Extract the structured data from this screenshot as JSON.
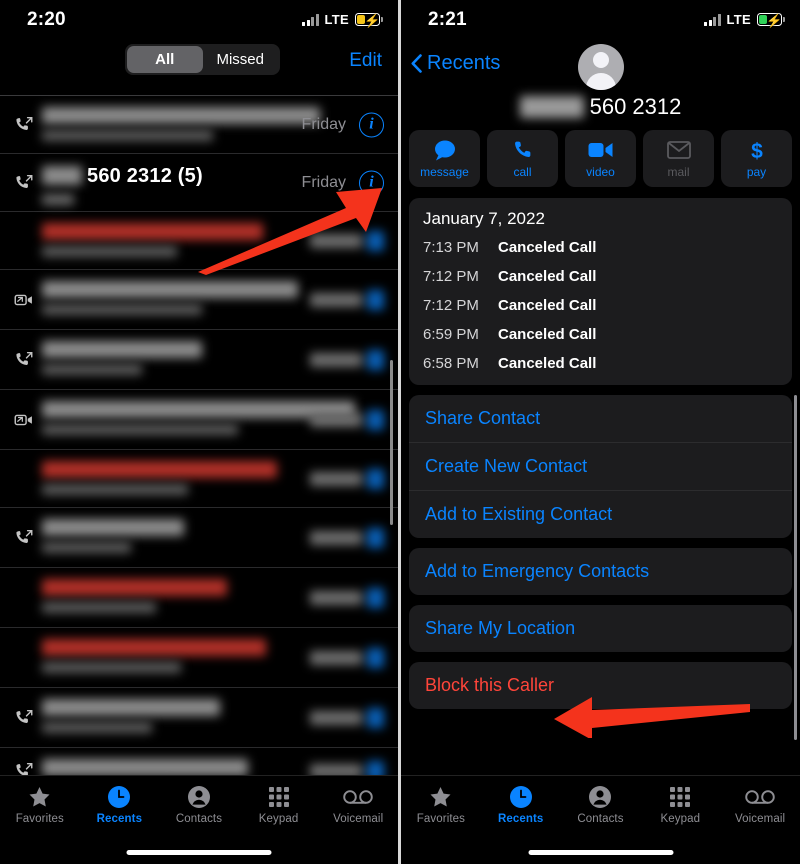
{
  "left": {
    "status": {
      "time": "2:20",
      "network": "LTE",
      "battery_color": "#f5c518",
      "charging": true
    },
    "header": {
      "segments": [
        {
          "label": "All",
          "active": true
        },
        {
          "label": "Missed",
          "active": false
        }
      ],
      "edit_label": "Edit"
    },
    "calls": [
      {
        "name": "",
        "redacted": true,
        "redaction_color": "#8c8c8c",
        "width_pct": 78,
        "when": "Friday",
        "when_visible": true,
        "info": "i",
        "icon": "outgoing-call-icon",
        "height": 58
      },
      {
        "name": "560 2312 (5)",
        "redacted": true,
        "redaction_color": "#8c8c8c",
        "width_pct": 36,
        "when": "Friday",
        "when_visible": true,
        "info": "i",
        "icon": "outgoing-call-icon",
        "height": 58
      },
      {
        "name": "",
        "redacted": true,
        "redaction_color": "#b03028",
        "width_pct": 62,
        "when": "",
        "when_visible": false,
        "info": "i",
        "icon": "none",
        "height": 58
      },
      {
        "name": "",
        "redacted": true,
        "redaction_color": "#8c8c8c",
        "width_pct": 72,
        "when": "",
        "when_visible": false,
        "info": "i",
        "icon": "video-call-icon",
        "height": 60
      },
      {
        "name": "",
        "redacted": true,
        "redaction_color": "#8c8c8c",
        "width_pct": 45,
        "when": "",
        "when_visible": false,
        "info": "i",
        "icon": "outgoing-call-icon",
        "height": 60
      },
      {
        "name": "",
        "redacted": true,
        "redaction_color": "#8c8c8c",
        "width_pct": 88,
        "when": "",
        "when_visible": false,
        "info": "i",
        "icon": "video-call-icon",
        "height": 60
      },
      {
        "name": "",
        "redacted": true,
        "redaction_color": "#b03028",
        "width_pct": 66,
        "when": "",
        "when_visible": false,
        "info": "i",
        "icon": "none",
        "height": 58
      },
      {
        "name": "",
        "redacted": true,
        "redaction_color": "#8c8c8c",
        "width_pct": 40,
        "when": "",
        "when_visible": false,
        "info": "i",
        "icon": "outgoing-call-icon",
        "height": 60
      },
      {
        "name": "",
        "redacted": true,
        "redaction_color": "#b03028",
        "width_pct": 52,
        "when": "",
        "when_visible": false,
        "info": "i",
        "icon": "none",
        "height": 60
      },
      {
        "name": "",
        "redacted": true,
        "redaction_color": "#b03028",
        "width_pct": 63,
        "when": "",
        "when_visible": false,
        "info": "i",
        "icon": "none",
        "height": 60
      },
      {
        "name": "",
        "redacted": true,
        "redaction_color": "#8c8c8c",
        "width_pct": 50,
        "when": "",
        "when_visible": false,
        "info": "i",
        "icon": "outgoing-call-icon",
        "height": 60
      },
      {
        "name": "",
        "redacted": true,
        "redaction_color": "#8c8c8c",
        "width_pct": 58,
        "when": "",
        "when_visible": false,
        "info": "i",
        "icon": "outgoing-call-icon",
        "height": 46
      }
    ],
    "tabs": [
      {
        "label": "Favorites",
        "icon": "star-icon",
        "active": false
      },
      {
        "label": "Recents",
        "icon": "clock-icon",
        "active": true
      },
      {
        "label": "Contacts",
        "icon": "person-circle-icon",
        "active": false
      },
      {
        "label": "Keypad",
        "icon": "keypad-icon",
        "active": false
      },
      {
        "label": "Voicemail",
        "icon": "voicemail-icon",
        "active": false
      }
    ]
  },
  "right": {
    "status": {
      "time": "2:21",
      "network": "LTE",
      "battery_color": "#30d158",
      "charging": true
    },
    "nav": {
      "back_label": "Recents"
    },
    "contact": {
      "number": "560 2312",
      "redacted_prefix": true
    },
    "actions": [
      {
        "label": "message",
        "icon": "message-bubble-icon",
        "disabled": false
      },
      {
        "label": "call",
        "icon": "phone-icon",
        "disabled": false
      },
      {
        "label": "video",
        "icon": "video-camera-icon",
        "disabled": false
      },
      {
        "label": "mail",
        "icon": "envelope-icon",
        "disabled": true
      },
      {
        "label": "pay",
        "icon": "dollar-sign-icon",
        "disabled": false
      }
    ],
    "history": {
      "date": "January 7, 2022",
      "entries": [
        {
          "time": "7:13 PM",
          "kind": "Canceled Call"
        },
        {
          "time": "7:12 PM",
          "kind": "Canceled Call"
        },
        {
          "time": "7:12 PM",
          "kind": "Canceled Call"
        },
        {
          "time": "6:59 PM",
          "kind": "Canceled Call"
        },
        {
          "time": "6:58 PM",
          "kind": "Canceled Call"
        }
      ]
    },
    "menu_groups": [
      {
        "items": [
          {
            "label": "Share Contact",
            "danger": false
          },
          {
            "label": "Create New Contact",
            "danger": false
          },
          {
            "label": "Add to Existing Contact",
            "danger": false
          }
        ]
      },
      {
        "items": [
          {
            "label": "Add to Emergency Contacts",
            "danger": false
          }
        ]
      },
      {
        "items": [
          {
            "label": "Share My Location",
            "danger": false
          }
        ]
      },
      {
        "items": [
          {
            "label": "Block this Caller",
            "danger": true
          }
        ]
      }
    ],
    "tabs": [
      {
        "label": "Favorites",
        "icon": "star-icon",
        "active": false
      },
      {
        "label": "Recents",
        "icon": "clock-icon",
        "active": true
      },
      {
        "label": "Contacts",
        "icon": "person-circle-icon",
        "active": false
      },
      {
        "label": "Keypad",
        "icon": "keypad-icon",
        "active": false
      },
      {
        "label": "Voicemail",
        "icon": "voicemail-icon",
        "active": false
      }
    ]
  },
  "annotations": {
    "arrow_color": "#f4331c",
    "arrows": [
      {
        "name": "arrow-to-info-button",
        "target": "info-button-row-2"
      },
      {
        "name": "arrow-to-block-caller",
        "target": "block-this-caller"
      }
    ]
  }
}
